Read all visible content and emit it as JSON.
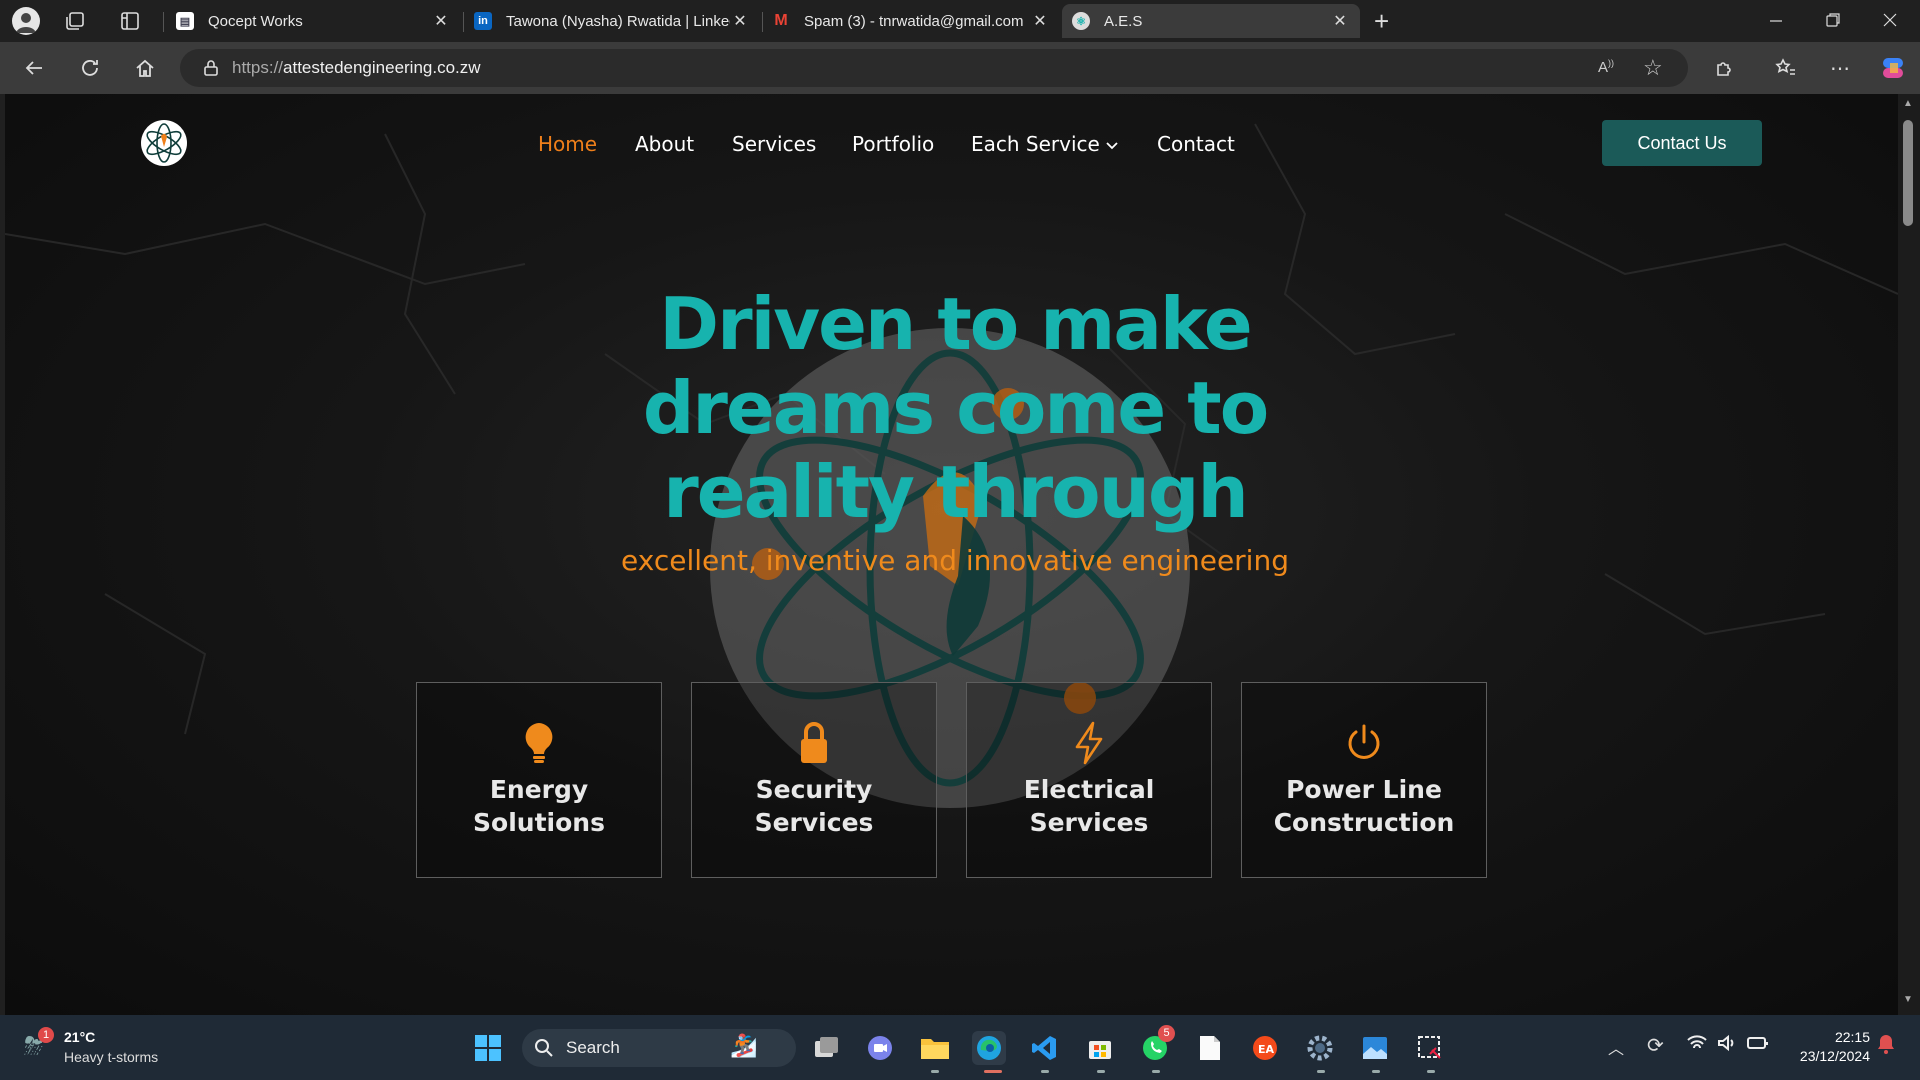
{
  "browser": {
    "tabs": [
      {
        "title": "Qocept Works",
        "favicon": "doc-favicon"
      },
      {
        "title": "Tawona (Nyasha) Rwatida | LinkedIn",
        "favicon": "linkedin-favicon"
      },
      {
        "title": "Spam (3) - tnrwatida@gmail.com",
        "favicon": "gmail-favicon"
      },
      {
        "title": "A.E.S",
        "favicon": "aes-favicon"
      }
    ],
    "address": {
      "scheme": "https://",
      "host": "attestedengineering.co.zw"
    }
  },
  "site": {
    "nav": {
      "items": [
        "Home",
        "About",
        "Services",
        "Portfolio",
        "Each Service",
        "Contact"
      ],
      "active": "Home",
      "cta": "Contact Us"
    },
    "hero": {
      "title": "Driven to make dreams come to reality through",
      "subtitle": "excellent, inventive and innovative engineering"
    },
    "services": [
      {
        "icon": "lightbulb-icon",
        "label": "Energy Solutions"
      },
      {
        "icon": "lock-icon",
        "label": "Security Services"
      },
      {
        "icon": "lightning-icon",
        "label": "Electrical Services"
      },
      {
        "icon": "power-icon",
        "label": "Power Line Construction"
      }
    ],
    "colors": {
      "accent_teal": "#17b3ae",
      "accent_orange": "#ef7f1a",
      "cta_bg": "#1b5a58"
    }
  },
  "taskbar": {
    "weather": {
      "temp": "21°C",
      "desc": "Heavy t-storms",
      "badge": "1"
    },
    "search_placeholder": "Search",
    "whatsapp_badge": "5",
    "clock": {
      "time": "22:15",
      "date": "23/12/2024"
    }
  }
}
